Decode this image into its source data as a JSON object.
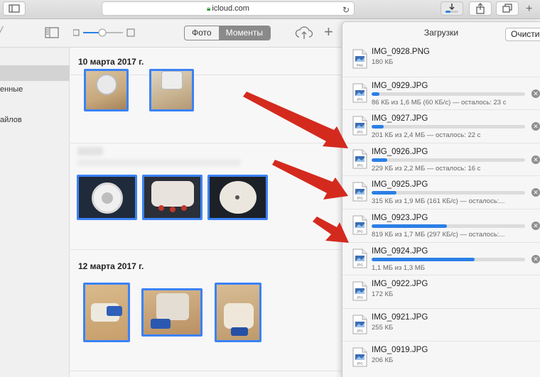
{
  "browser": {
    "url": "icloud.com"
  },
  "app": {
    "segments": [
      "Фото",
      "Моменты"
    ],
    "active_segment": 1
  },
  "sidebar": {
    "items": [
      "енные",
      "айлов"
    ]
  },
  "main": {
    "dates": [
      "10 марта 2017 г.",
      "12 марта 2017 г."
    ]
  },
  "downloads": {
    "title": "Загрузки",
    "clear_label": "Очистить",
    "items": [
      {
        "name": "IMG_0928.PNG",
        "status": "180 КБ",
        "progress": null
      },
      {
        "name": "IMG_0929.JPG",
        "status": "86 КБ из 1,6 МБ (60 КБ/с) — осталось: 23 с",
        "progress": 0.05
      },
      {
        "name": "IMG_0927.JPG",
        "status": "201 КБ из 2,4 МБ — осталось: 22 с",
        "progress": 0.08
      },
      {
        "name": "IMG_0926.JPG",
        "status": "229 КБ из 2,2 МБ — осталось: 16 с",
        "progress": 0.1
      },
      {
        "name": "IMG_0925.JPG",
        "status": "315 КБ из 1,9 МБ (161 КБ/с) — осталось:...",
        "progress": 0.16
      },
      {
        "name": "IMG_0923.JPG",
        "status": "819 КБ из 1,7 МБ (297 КБ/с) — осталось:...",
        "progress": 0.49
      },
      {
        "name": "IMG_0924.JPG",
        "status": "1,1 МБ из 1,3 МБ",
        "progress": 0.67
      },
      {
        "name": "IMG_0922.JPG",
        "status": "172 КБ",
        "progress": null
      },
      {
        "name": "IMG_0921.JPG",
        "status": "255 КБ",
        "progress": null
      },
      {
        "name": "IMG_0919.JPG",
        "status": "206 КБ",
        "progress": null
      }
    ]
  },
  "colors": {
    "accent": "#2b7fe6",
    "selection": "#3b82f6",
    "arrow": "#d42a1e"
  }
}
